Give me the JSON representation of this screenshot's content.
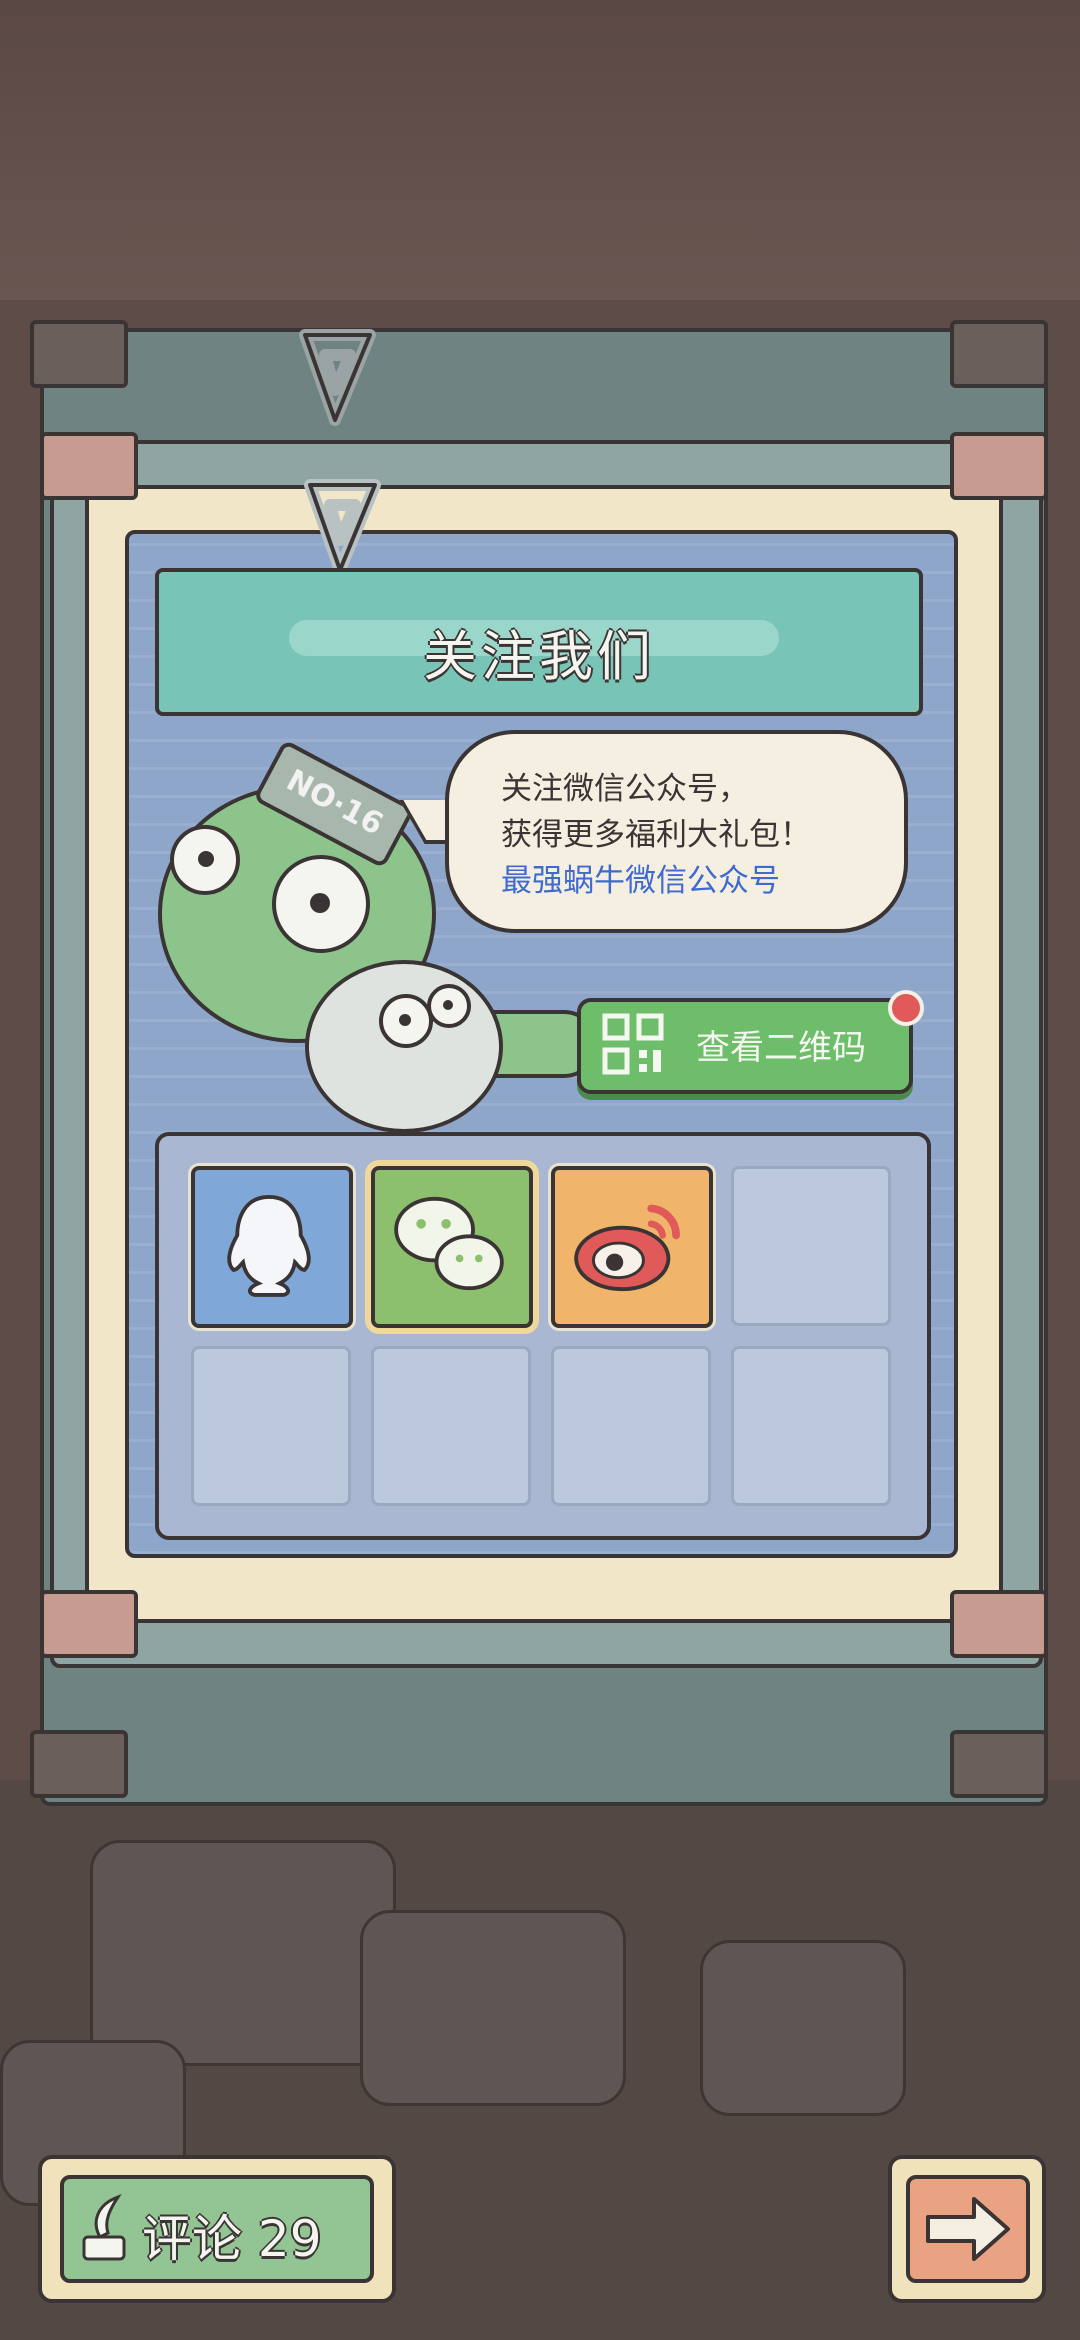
{
  "dialog": {
    "title": "关注我们",
    "message_line1": "关注微信公众号，",
    "message_line2": "获得更多福利大礼包！",
    "link_text": "最强蜗牛微信公众号",
    "qr_button_label": "查看二维码",
    "mascot_headband": "NO·16"
  },
  "share_slots": [
    {
      "icon": "qq-icon",
      "color": "#7fa8d8"
    },
    {
      "icon": "wechat-icon",
      "color": "#8dc06d",
      "selected": true
    },
    {
      "icon": "weibo-icon",
      "color": "#f0b56a"
    },
    {
      "icon": "",
      "color": ""
    },
    {
      "icon": "",
      "color": ""
    },
    {
      "icon": "",
      "color": ""
    },
    {
      "icon": "",
      "color": ""
    },
    {
      "icon": "",
      "color": ""
    }
  ],
  "footer": {
    "comment_label": "评论",
    "comment_count": "29"
  },
  "colors": {
    "accent_teal": "#78c4b6",
    "panel_blue": "#8fa6cb",
    "button_green": "#6dbd6a",
    "notification_red": "#e05a5a",
    "link_blue": "#3f6bd0"
  }
}
